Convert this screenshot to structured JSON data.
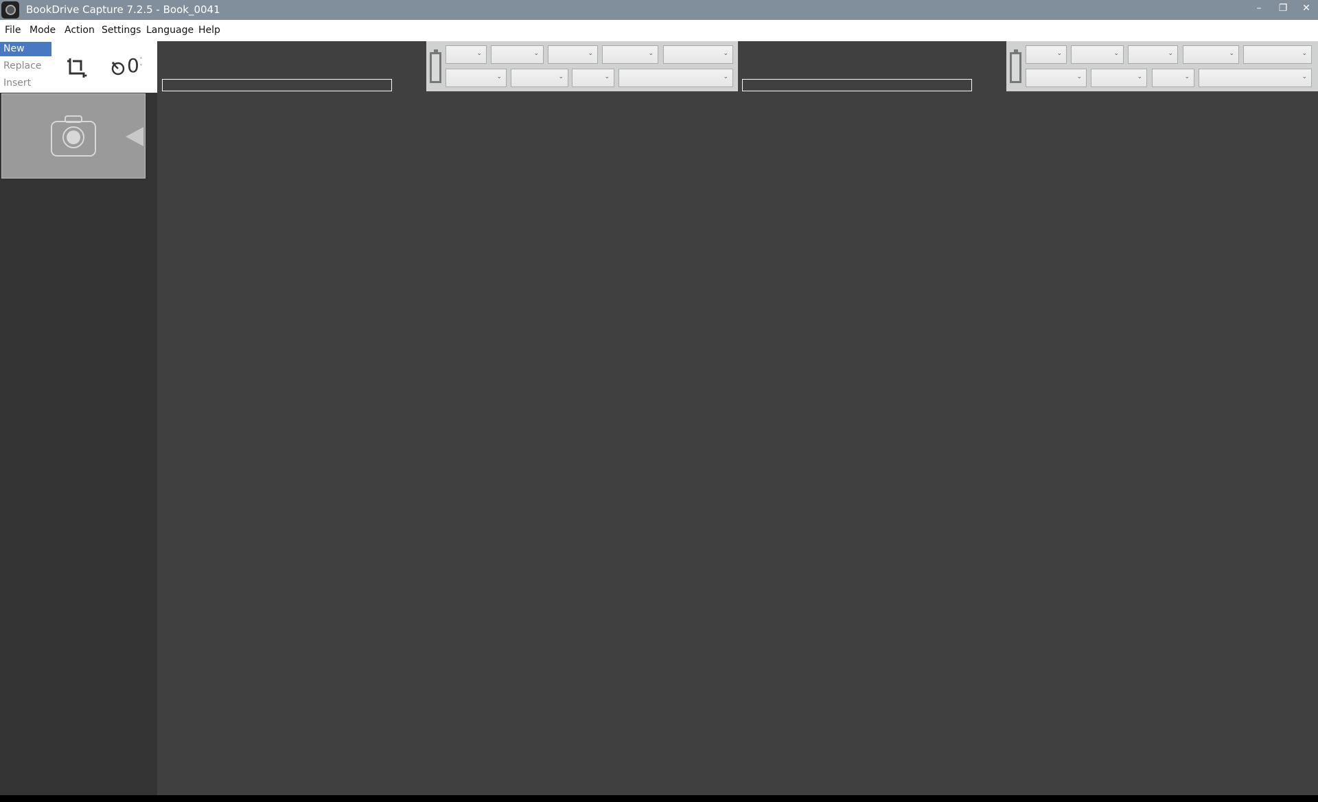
{
  "window": {
    "title": "BookDrive Capture 7.2.5 - Book_0041",
    "minimize": "–",
    "restore": "❐",
    "close": "✕"
  },
  "menu": [
    "File",
    "Mode",
    "Action",
    "Settings",
    "Language",
    "Help"
  ],
  "modes": {
    "items": [
      "New",
      "Replace",
      "Insert"
    ],
    "selected": "New"
  },
  "toolbar": {
    "crop_icon": "crop-icon",
    "timer_icon": "timer-icon",
    "timer_value": "0",
    "stepper_up": "˄",
    "stepper_down": "˅"
  },
  "dropdown_arrow": "⌄",
  "colors": {
    "titlebar": "#818e9b",
    "selected": "#4a79c3",
    "sidebar": "#333333",
    "workspace": "#404040"
  }
}
